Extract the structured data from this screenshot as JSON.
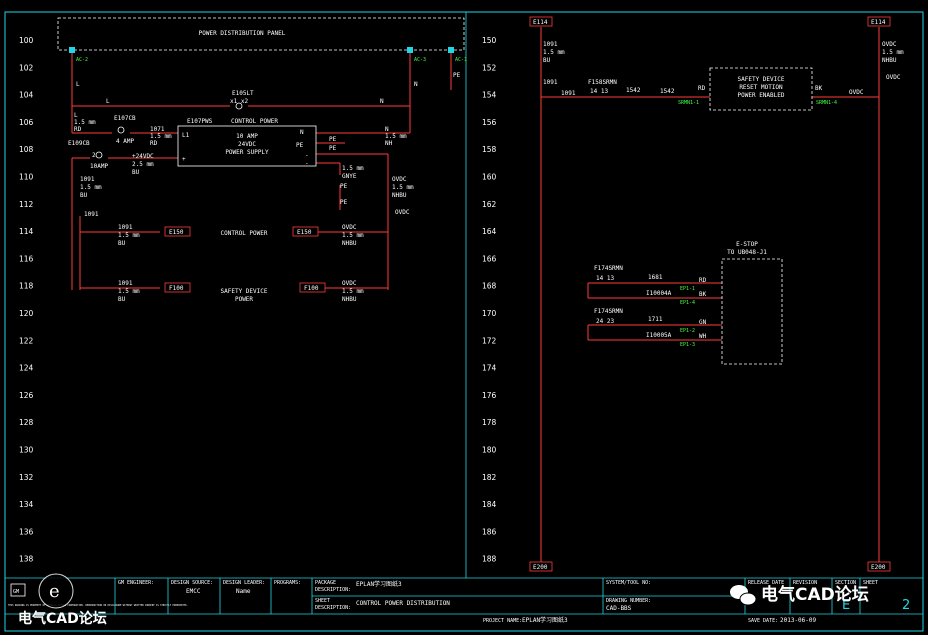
{
  "rung_numbers_left": [
    "100",
    "102",
    "104",
    "106",
    "108",
    "110",
    "112",
    "114",
    "116",
    "118",
    "120",
    "122",
    "124",
    "126",
    "128",
    "130",
    "132",
    "134",
    "136",
    "138"
  ],
  "rung_numbers_right": [
    "150",
    "152",
    "154",
    "156",
    "158",
    "160",
    "162",
    "164",
    "166",
    "168",
    "170",
    "172",
    "174",
    "176",
    "178",
    "180",
    "182",
    "184",
    "186",
    "188"
  ],
  "left_page": {
    "panel_title": "POWER DISTRIBUTION PANEL",
    "terminal_ac2": "AC-2",
    "terminal_ac3": "AC-3",
    "terminal_ac1": "AC-1",
    "l_label": "L",
    "n_label": "N",
    "pe_label": "PE",
    "breaker_main_tag": "E105LT",
    "breaker_main_pins": "x1  x2",
    "wire_l": "L",
    "wire_n": "N",
    "wire_l2": "L",
    "wire_l_size": "1.5 mm",
    "wire_l_color": "RD",
    "breaker_e107cb_tag": "E107CB",
    "breaker_e107cb_rating": "4 AMP",
    "wire_1071": "1071",
    "wire_1071_size": "1.5 mm",
    "wire_1071_color": "RD",
    "ps_tag": "E107PWS",
    "ps_title": "CONTROL POWER",
    "ps_rating_1": "10 AMP",
    "ps_rating_2": "24VDC",
    "ps_rating_3": "POWER SUPPLY",
    "ps_pin_l1": "L1",
    "ps_pin_n": "N",
    "ps_pin_pe": "PE",
    "ps_pin_plus": "+",
    "ps_pin_minus_1": "-",
    "ps_pin_minus_2": "-",
    "n_wire": "N",
    "n_wire_size": "1.5 mm",
    "n_wire_color": "NH",
    "pe_out": "PE",
    "pe_term": "PE",
    "e109cb_tag": "E109CB",
    "e109cb_rating": "10AMP",
    "e109cb_pin": "2",
    "w24vdc": "+24VDC",
    "w24vdc_size": "2.5 mm",
    "w24vdc_color": "BU",
    "w1091_a": "1091",
    "w1091_a_size": "1.5 mm",
    "w1091_a_color": "BU",
    "w1091_b": "1091",
    "gnye_size": "1.5 mm",
    "gnye": "GNYE",
    "pe_a": "PE",
    "pe_b": "PE",
    "ovdc_a": "OVDC",
    "ovdc_a_size": "1.5 mm",
    "ovdc_a_color": "NHBU",
    "ovdc_b": "OVDC",
    "cp_w1": "1091",
    "cp_w1_size": "1.5 mm",
    "cp_w1_color": "BU",
    "cp_ref_left": "E150",
    "cp_label": "CONTROL POWER",
    "cp_ref_right": "E150",
    "cp_w2": "OVDC",
    "cp_w2_size": "1.5 mm",
    "cp_w2_color": "NHBU",
    "sd_w1": "1091",
    "sd_w1_size": "1.5 mm",
    "sd_w1_color": "BU",
    "sd_ref_left": "F100",
    "sd_label_1": "SAFETY DEVICE",
    "sd_label_2": "POWER",
    "sd_ref_right": "F100",
    "sd_w2": "OVDC",
    "sd_w2_size": "1.5 mm",
    "sd_w2_color": "NHBU"
  },
  "right_page": {
    "ref_top_left": "E114",
    "ref_top_right": "E114",
    "ref_bottom_left": "E200",
    "ref_bottom_right": "E200",
    "l_wire": "1091",
    "l_wire_size": "1.5 mm",
    "l_wire_color": "BU",
    "r_wire": "OVDC",
    "r_wire_size": "1.5 mm",
    "r_wire_color": "NHBU",
    "r_wire2": "OVDC",
    "w1091": "1091",
    "w1091b": "1091",
    "relay_tag": "F158SRMN",
    "relay_pins": "14    13",
    "w1542a": "1542",
    "w1542b": "1542",
    "sd_box_1": "SAFETY DEVICE",
    "sd_box_2": "RESET MOTION",
    "sd_box_3": "POWER ENABLED",
    "rd": "RD",
    "bk": "BK",
    "srmn_1": "SRMN1-1",
    "srmn_4": "SRMN1-4",
    "ovdc_mid": "OVDC",
    "estop_1": "E-STOP",
    "estop_2": "TO UB048-J1",
    "f174_a_tag": "F174SRMN",
    "f174_a_pins": "14    13",
    "w1681": "1681",
    "i10004a": "I10004A",
    "rd2": "RD",
    "bk2": "BK",
    "ep1_1": "EP1-1",
    "ep1_4": "EP1-4",
    "f174_b_tag": "F174SRMN",
    "f174_b_pins": "24    23",
    "w1711": "1711",
    "i10005a": "I10005A",
    "gn": "GN",
    "wh": "WH",
    "ep1_2": "EP1-2",
    "ep1_3": "EP1-3"
  },
  "title_block": {
    "logo": "GM",
    "gm_engineer_label": "GM ENGINEER:",
    "design_source_label": "DESIGN SOURCE:",
    "design_source_value": "EMCC",
    "design_leader_label": "DESIGN LEADER:",
    "design_leader_value": "Name",
    "programs_label": "PROGRAMS:",
    "package_label": "PACKAGE",
    "package_desc_label": "DESCRIPTION:",
    "package_value": "EPLAN学习图纸3",
    "sheet_label": "SHEET",
    "sheet_desc_label": "DESCRIPTION:",
    "sheet_value": "CONTROL POWER DISTRIBUTION",
    "system_label": "SYSTEM/TOOL NO:",
    "drawing_label": "DRAWING NUMBER:",
    "drawing_value": "CAD-BBS",
    "release_label": "RELEASE DATE",
    "revision_label": "REVISION",
    "section_label": "SECTION",
    "sheet_no_label": "SHEET",
    "section_value": "E",
    "sheet_no_value": "2",
    "project_name_label": "PROJECT NAME:",
    "project_name_value": "EPLAN学习图纸3",
    "save_date_label": "SAVE DATE:",
    "save_date_value": "2013-06-09",
    "copyright_text": "THIS DRAWING IS PROPERTY OF GENERAL MOTORS CORPORATION. REPRODUCTION OR DISCLOSURE WITHOUT WRITTEN CONSENT IS STRICTLY PROHIBITED."
  },
  "watermark": {
    "wechat": "电气CAD论坛",
    "corner": "电气CAD论坛"
  },
  "colors": {
    "wire": "#ff3a3a",
    "frame": "#1fd7e6",
    "text": "#ffffff",
    "tag": "#3dff3d"
  }
}
